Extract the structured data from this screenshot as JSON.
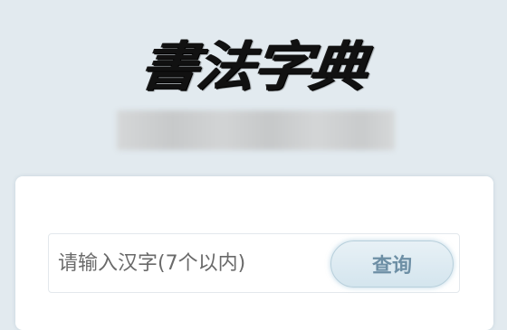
{
  "header": {
    "logo_text": "書法字典"
  },
  "search": {
    "placeholder": "请输入汉字(7个以内)",
    "value": "",
    "button_label": "查询"
  },
  "colors": {
    "page_background": "#e2eaef",
    "card_background": "#ffffff",
    "button_text": "#6d8fa5",
    "button_border": "#b7cfdb"
  }
}
